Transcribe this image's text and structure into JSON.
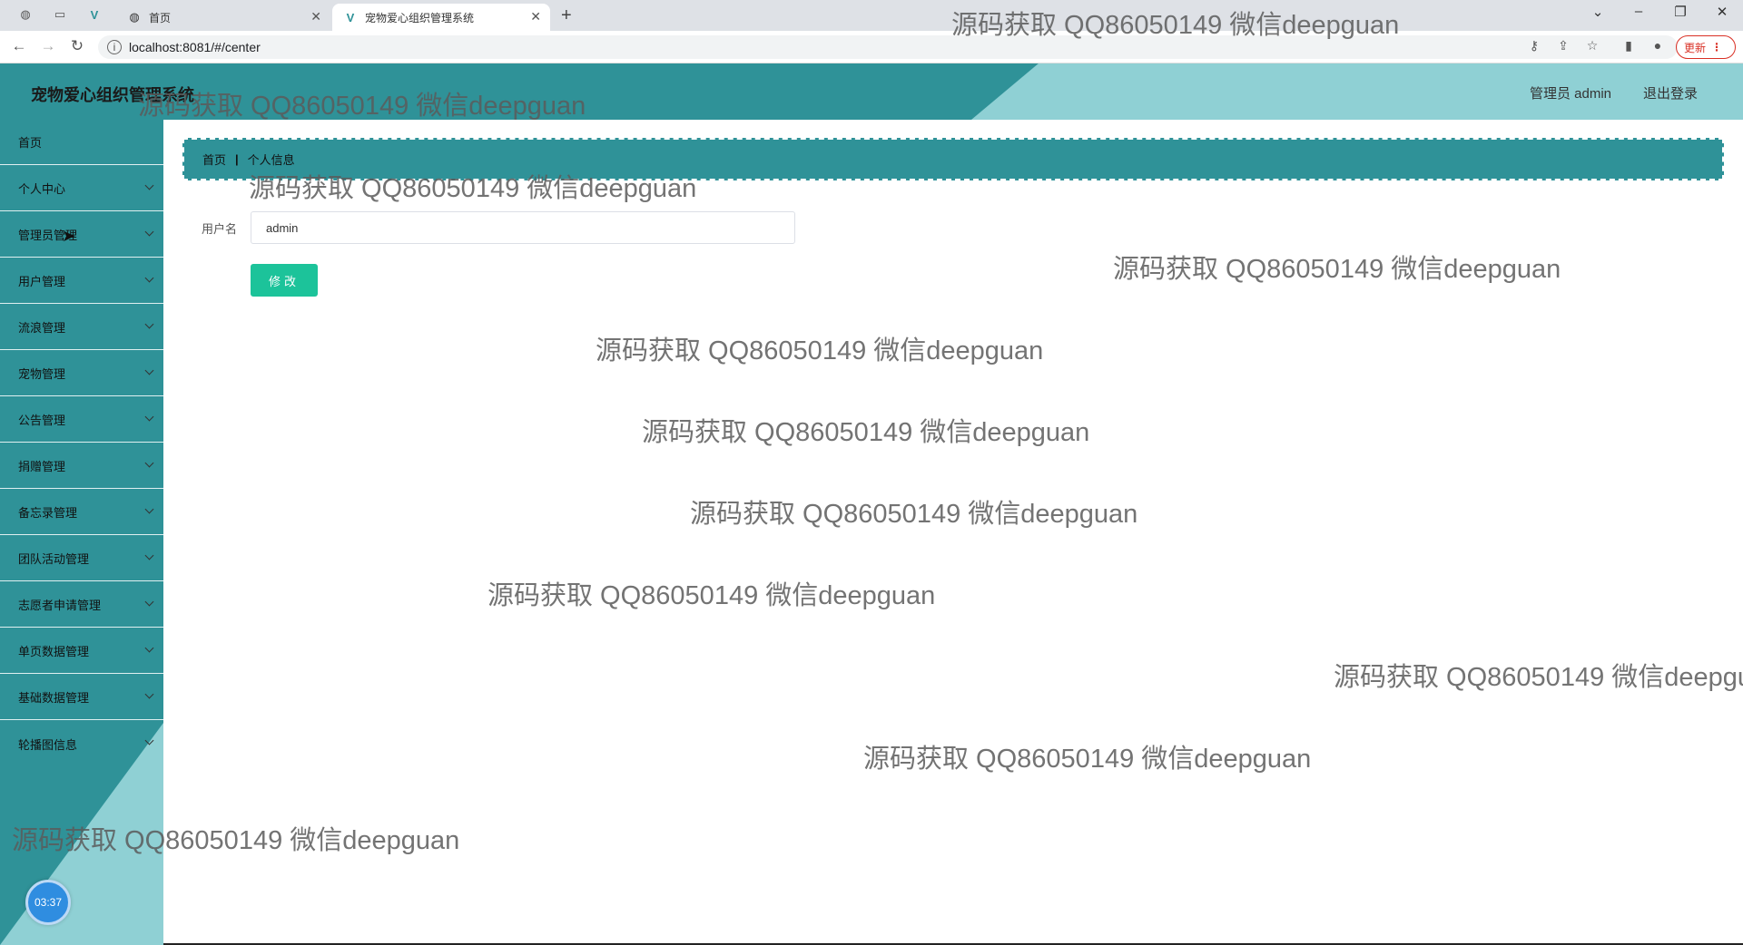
{
  "browser": {
    "tabs": [
      {
        "label": "首页"
      },
      {
        "label": "宠物爱心组织管理系统"
      }
    ],
    "url": "localhost:8081/#/center",
    "update_label": "更新"
  },
  "header": {
    "title": "宠物爱心组织管理系统",
    "user": "管理员 admin",
    "logout": "退出登录"
  },
  "sidebar": {
    "items": [
      {
        "label": "首页"
      },
      {
        "label": "个人中心"
      },
      {
        "label": "管理员管理"
      },
      {
        "label": "用户管理"
      },
      {
        "label": "流浪管理"
      },
      {
        "label": "宠物管理"
      },
      {
        "label": "公告管理"
      },
      {
        "label": "捐赠管理"
      },
      {
        "label": "备忘录管理"
      },
      {
        "label": "团队活动管理"
      },
      {
        "label": "志愿者申请管理"
      },
      {
        "label": "单页数据管理"
      },
      {
        "label": "基础数据管理"
      },
      {
        "label": "轮播图信息"
      }
    ],
    "clock": "03:37"
  },
  "breadcrumb": {
    "home": "首页",
    "sep": "|",
    "current": "个人信息"
  },
  "form": {
    "username_label": "用户名",
    "username_value": "admin",
    "submit_label": "修改"
  },
  "watermark": "源码获取 QQ86050149 微信deepguan",
  "colors": {
    "primary": "#2f9298",
    "light": "#8fd0d4",
    "button": "#1cc39a"
  }
}
